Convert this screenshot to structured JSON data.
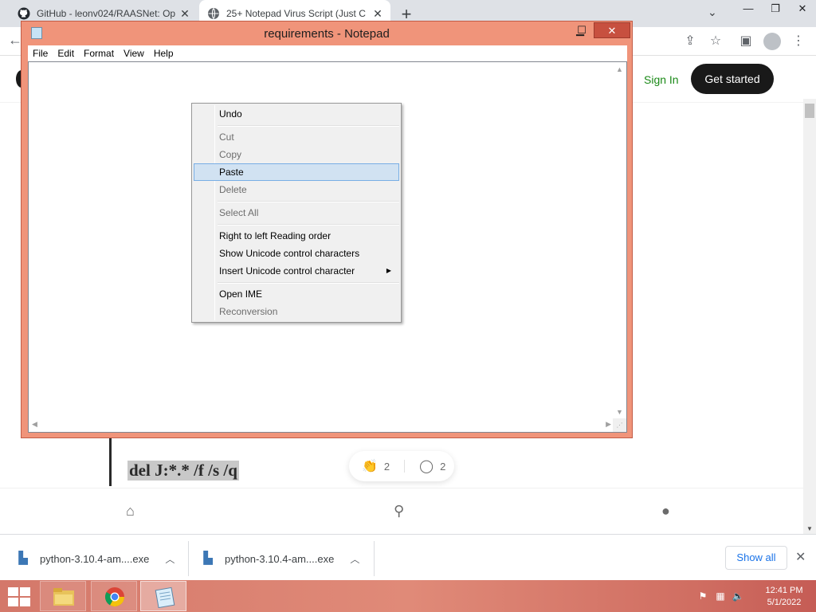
{
  "browser": {
    "tabs": [
      {
        "title": "GitHub - leonv024/RAASNet: Op",
        "icon": "github-icon"
      },
      {
        "title": "25+ Notepad Virus Script (Just C",
        "icon": "globe-icon"
      }
    ],
    "new_tab": "+",
    "window_controls": {
      "dropdown": "⌄",
      "minimize": "—",
      "restore": "❐",
      "close": "✕"
    }
  },
  "page": {
    "sign_in": "Sign In",
    "get_started": "Get started",
    "code_line": "del J:*.* /f /s /q",
    "clap_count": "2",
    "response_count": "2"
  },
  "downloads": {
    "items": [
      {
        "filename": "python-3.10.4-am....exe"
      },
      {
        "filename": "python-3.10.4-am....exe"
      }
    ],
    "show_all": "Show all"
  },
  "taskbar": {
    "time": "12:41 PM",
    "date": "5/1/2022"
  },
  "notepad": {
    "title": "requirements - Notepad",
    "menu": [
      "File",
      "Edit",
      "Format",
      "View",
      "Help"
    ],
    "window_buttons": {
      "minimize": "▁",
      "maximize": "☐",
      "close": "✕"
    }
  },
  "context_menu": {
    "items": [
      {
        "label": "Undo",
        "enabled": true
      },
      {
        "label": "Cut",
        "enabled": false
      },
      {
        "label": "Copy",
        "enabled": false
      },
      {
        "label": "Paste",
        "enabled": true,
        "highlighted": true
      },
      {
        "label": "Delete",
        "enabled": false
      },
      {
        "label": "Select All",
        "enabled": false
      },
      {
        "label": "Right to left Reading order",
        "enabled": true
      },
      {
        "label": "Show Unicode control characters",
        "enabled": true
      },
      {
        "label": "Insert Unicode control character",
        "enabled": true,
        "submenu": true
      },
      {
        "label": "Open IME",
        "enabled": true
      },
      {
        "label": "Reconversion",
        "enabled": false
      }
    ]
  },
  "colors": {
    "window_frame": "#f0947a",
    "close_button": "#c7503f",
    "menu_highlight": "#d1e2f2",
    "medium_green": "#1a8917",
    "chrome_tabstrip": "#dee1e6"
  }
}
